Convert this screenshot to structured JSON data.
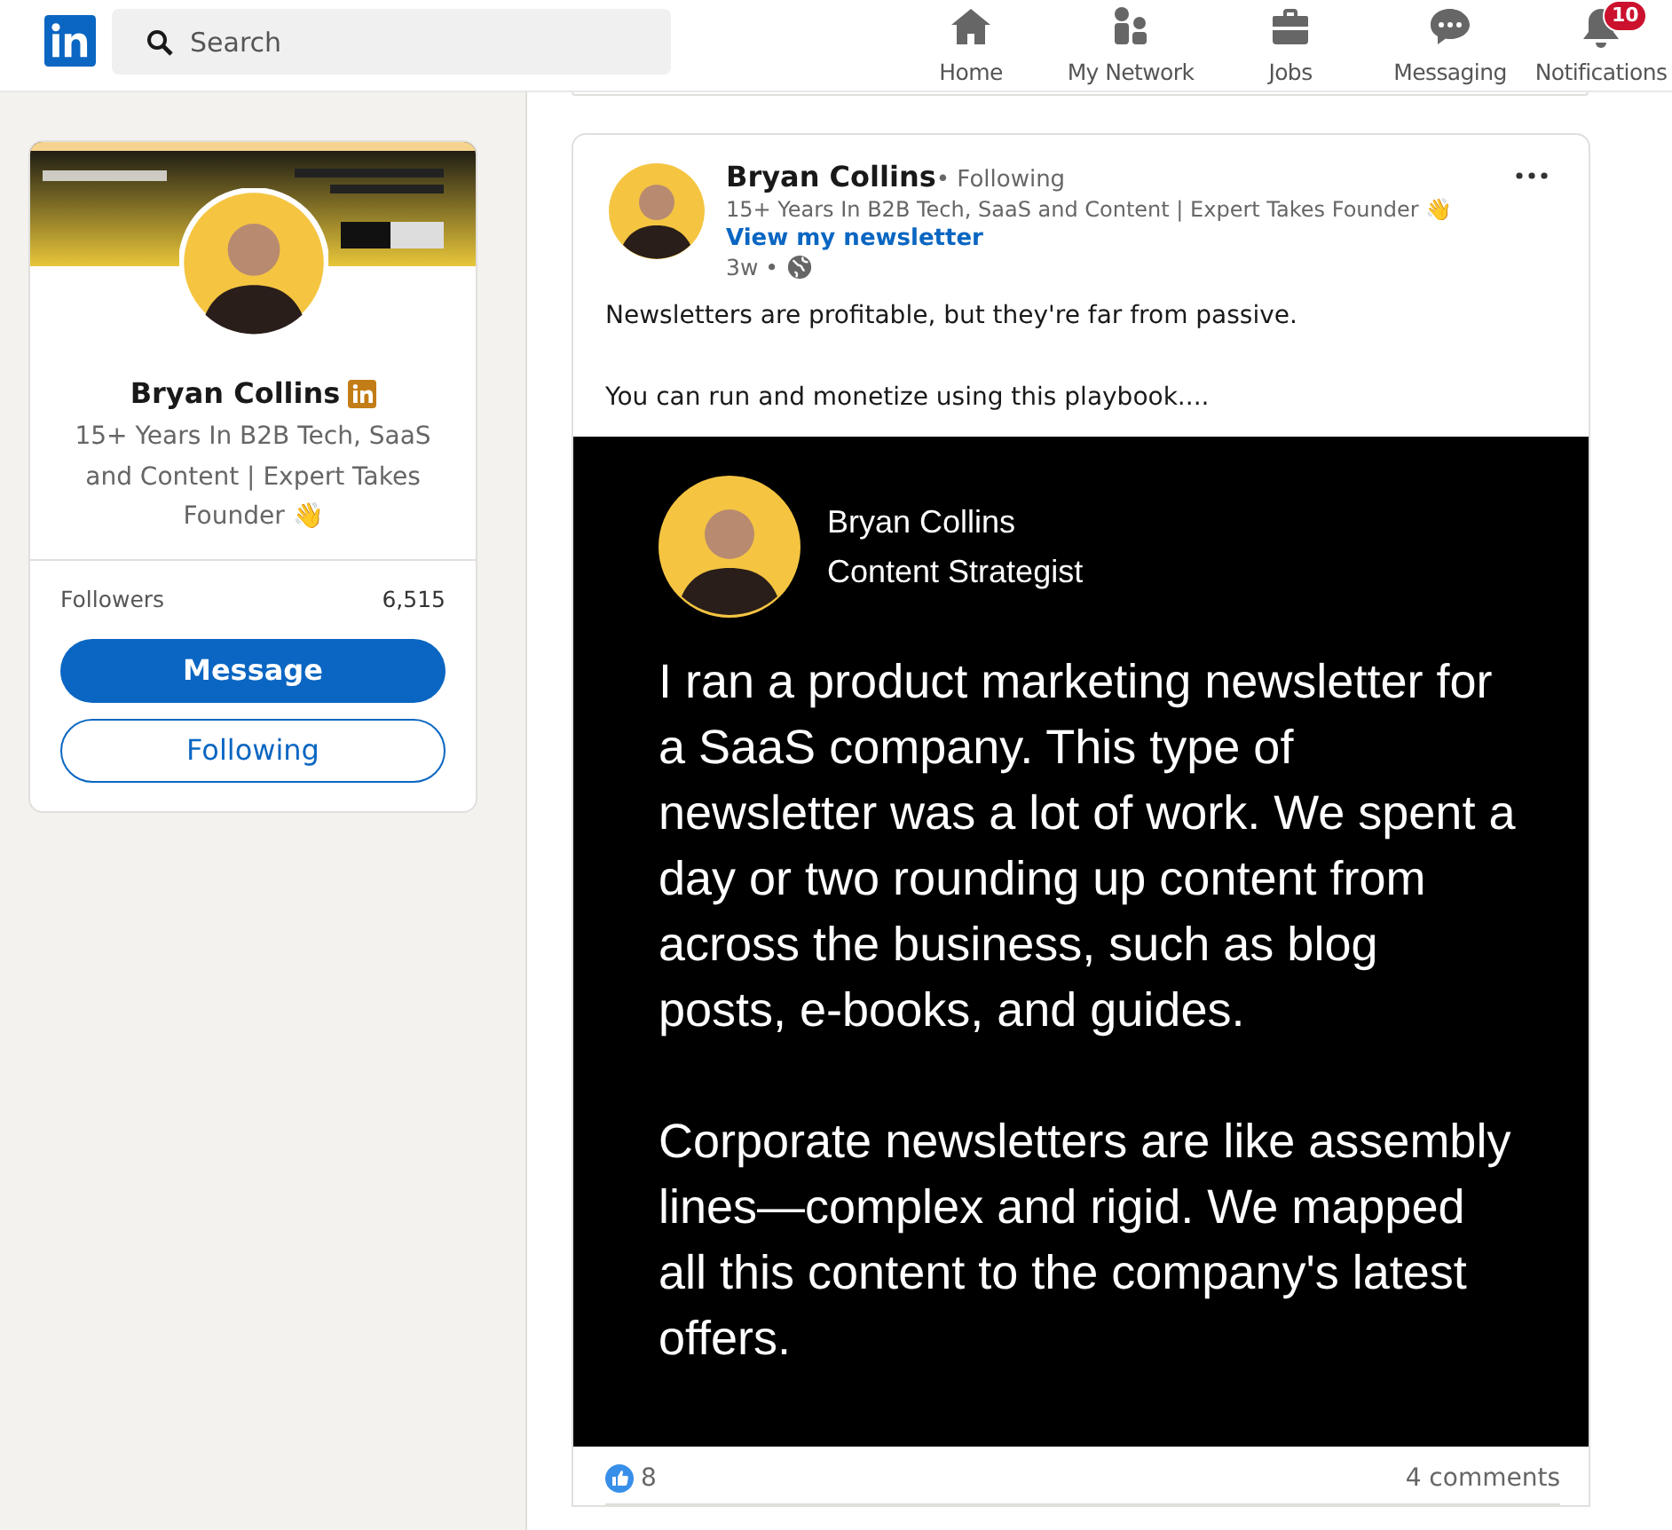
{
  "nav": {
    "search": {
      "placeholder": "Search"
    },
    "items": [
      {
        "kind": "home",
        "label": "Home"
      },
      {
        "kind": "network",
        "label": "My Network"
      },
      {
        "kind": "jobs",
        "label": "Jobs"
      },
      {
        "kind": "messaging",
        "label": "Messaging"
      },
      {
        "kind": "notifications",
        "label": "Notifications",
        "badge": "10"
      }
    ]
  },
  "profile": {
    "name": "Bryan Collins",
    "headline": "15+ Years In B2B Tech, SaaS and Content | Expert Takes Founder 👋",
    "stats": [
      {
        "label": "Followers",
        "value": "6,515"
      }
    ],
    "buttons": [
      {
        "label": "Message",
        "kind": "primary"
      },
      {
        "label": "Following",
        "kind": "outline"
      }
    ]
  },
  "post": {
    "author": "Bryan Collins",
    "relation": "• Following",
    "headline": "15+ Years In B2B Tech, SaaS and Content | Expert Takes Founder 👋",
    "link": "View my newsletter",
    "age": "3w •",
    "text": [
      "Newsletters are profitable, but they're far from passive.",
      "You can run and monetize using this playbook...."
    ],
    "slide": {
      "name": "Bryan Collins",
      "role": "Content Strategist",
      "paragraphs": [
        "I ran a product marketing newsletter for a SaaS company. This type of newsletter was a lot of work. We spent a day or two rounding up content from across the business, such as blog posts, e-books, and guides.",
        "Corporate newsletters are like assembly lines—complex and rigid. We mapped all this content to the company's latest offers."
      ]
    },
    "reactions": "8",
    "comments": "4 comments"
  }
}
